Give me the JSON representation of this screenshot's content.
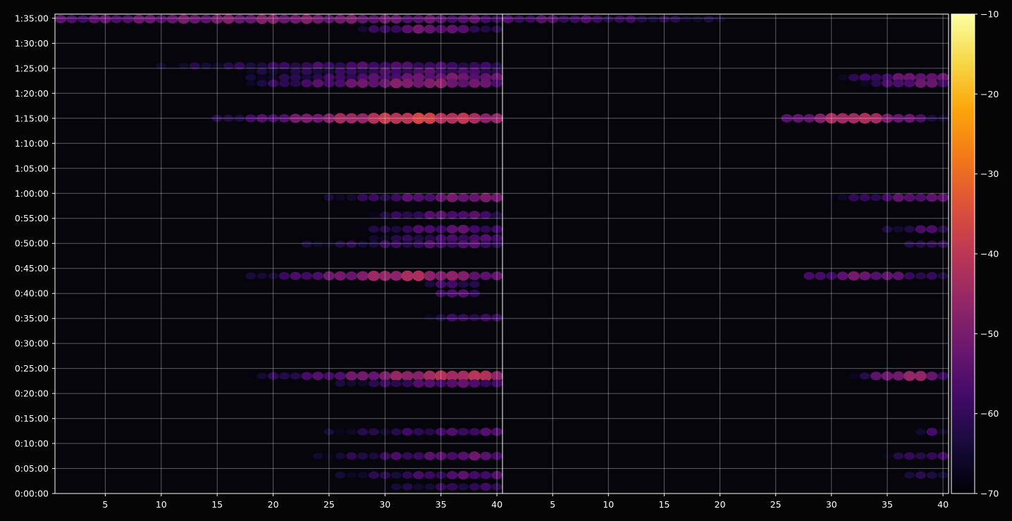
{
  "chart_data": {
    "type": "heatmap",
    "title": "",
    "xlabel": "",
    "ylabel": "",
    "panels": [
      {
        "name": "",
        "xlim": [
          1,
          40
        ],
        "x_ticks": [
          5,
          10,
          15,
          20,
          25,
          30,
          35,
          40
        ]
      },
      {
        "name": "",
        "xlim": [
          1,
          40
        ],
        "x_ticks": [
          5,
          10,
          15,
          20,
          25,
          30,
          35,
          40
        ]
      }
    ],
    "y_axis": {
      "unit": "seconds",
      "range": [
        0,
        5750
      ],
      "ticks": [
        {
          "value": 0,
          "label": "0:00:00"
        },
        {
          "value": 300,
          "label": "0:05:00"
        },
        {
          "value": 600,
          "label": "0:10:00"
        },
        {
          "value": 900,
          "label": "0:15:00"
        },
        {
          "value": 1200,
          "label": "0:20:00"
        },
        {
          "value": 1500,
          "label": "0:25:00"
        },
        {
          "value": 1800,
          "label": "0:30:00"
        },
        {
          "value": 2100,
          "label": "0:35:00"
        },
        {
          "value": 2400,
          "label": "0:40:00"
        },
        {
          "value": 2700,
          "label": "0:45:00"
        },
        {
          "value": 3000,
          "label": "0:50:00"
        },
        {
          "value": 3300,
          "label": "0:55:00"
        },
        {
          "value": 3600,
          "label": "1:00:00"
        },
        {
          "value": 3900,
          "label": "1:05:00"
        },
        {
          "value": 4200,
          "label": "1:10:00"
        },
        {
          "value": 4500,
          "label": "1:15:00"
        },
        {
          "value": 4800,
          "label": "1:20:00"
        },
        {
          "value": 5100,
          "label": "1:25:00"
        },
        {
          "value": 5400,
          "label": "1:30:00"
        },
        {
          "value": 5700,
          "label": "1:35:00"
        }
      ]
    },
    "colorbar": {
      "colormap": "inferno",
      "range": [
        -70,
        -10
      ],
      "ticks": [
        {
          "value": -10,
          "label": "−10"
        },
        {
          "value": -20,
          "label": "−20"
        },
        {
          "value": -30,
          "label": "−30"
        },
        {
          "value": -40,
          "label": "−40"
        },
        {
          "value": -50,
          "label": "−50"
        },
        {
          "value": -60,
          "label": "−60"
        },
        {
          "value": -70,
          "label": "−70"
        }
      ]
    },
    "grid": true,
    "background_value": -70,
    "bands": [
      {
        "panel": 0,
        "t": 5690,
        "x0": 1,
        "x1": 40,
        "peak_x": 20,
        "peak": -50,
        "edge": -57
      },
      {
        "panel": 0,
        "t": 5570,
        "x0": 28,
        "x1": 40,
        "peak_x": 34,
        "peak": -52,
        "edge": -64
      },
      {
        "panel": 0,
        "t": 5130,
        "x0": 10,
        "x1": 40,
        "peak_x": 30,
        "peak": -57,
        "edge": -66
      },
      {
        "panel": 0,
        "t": 5060,
        "x0": 18,
        "x1": 40,
        "peak_x": 34,
        "peak": -57,
        "edge": -66
      },
      {
        "panel": 0,
        "t": 4990,
        "x0": 18,
        "x1": 40,
        "peak_x": 36,
        "peak": -52,
        "edge": -66
      },
      {
        "panel": 0,
        "t": 4920,
        "x0": 18,
        "x1": 40,
        "peak_x": 33,
        "peak": -49,
        "edge": -64
      },
      {
        "panel": 0,
        "t": 4500,
        "x0": 15,
        "x1": 40,
        "peak_x": 33,
        "peak": -38,
        "edge": -64
      },
      {
        "panel": 0,
        "t": 3550,
        "x0": 25,
        "x1": 40,
        "peak_x": 38,
        "peak": -51,
        "edge": -66
      },
      {
        "panel": 0,
        "t": 3340,
        "x0": 29,
        "x1": 40,
        "peak_x": 36,
        "peak": -55,
        "edge": -65
      },
      {
        "panel": 0,
        "t": 3170,
        "x0": 28,
        "x1": 40,
        "peak_x": 36,
        "peak": -55,
        "edge": -66
      },
      {
        "panel": 0,
        "t": 3060,
        "x0": 29,
        "x1": 40,
        "peak_x": 38,
        "peak": -57,
        "edge": -65
      },
      {
        "panel": 0,
        "t": 2990,
        "x0": 23,
        "x1": 40,
        "peak_x": 37,
        "peak": -57,
        "edge": -66
      },
      {
        "panel": 0,
        "t": 2610,
        "x0": 18,
        "x1": 40,
        "peak_x": 32,
        "peak": -44,
        "edge": -66
      },
      {
        "panel": 0,
        "t": 2510,
        "x0": 34,
        "x1": 38,
        "peak_x": 36,
        "peak": -58,
        "edge": -63
      },
      {
        "panel": 0,
        "t": 2400,
        "x0": 35,
        "x1": 38,
        "peak_x": 36,
        "peak": -55,
        "edge": -62
      },
      {
        "panel": 0,
        "t": 2110,
        "x0": 34,
        "x1": 40,
        "peak_x": 38,
        "peak": -59,
        "edge": -64
      },
      {
        "panel": 0,
        "t": 1410,
        "x0": 18,
        "x1": 40,
        "peak_x": 37,
        "peak": -42,
        "edge": -66
      },
      {
        "panel": 0,
        "t": 1320,
        "x0": 26,
        "x1": 40,
        "peak_x": 36,
        "peak": -55,
        "edge": -66
      },
      {
        "panel": 0,
        "t": 740,
        "x0": 25,
        "x1": 40,
        "peak_x": 39,
        "peak": -57,
        "edge": -66
      },
      {
        "panel": 0,
        "t": 450,
        "x0": 24,
        "x1": 40,
        "peak_x": 38,
        "peak": -54,
        "edge": -66
      },
      {
        "panel": 0,
        "t": 220,
        "x0": 26,
        "x1": 40,
        "peak_x": 38,
        "peak": -56,
        "edge": -66
      },
      {
        "panel": 0,
        "t": 80,
        "x0": 30,
        "x1": 40,
        "peak_x": 38,
        "peak": -60,
        "edge": -66
      },
      {
        "panel": 1,
        "t": 5690,
        "x0": 1,
        "x1": 20,
        "peak_x": 4,
        "peak": -57,
        "edge": -66
      },
      {
        "panel": 1,
        "t": 4990,
        "x0": 31,
        "x1": 40,
        "peak_x": 38,
        "peak": -52,
        "edge": -64
      },
      {
        "panel": 1,
        "t": 4920,
        "x0": 33,
        "x1": 40,
        "peak_x": 38,
        "peak": -53,
        "edge": -64
      },
      {
        "panel": 1,
        "t": 4500,
        "x0": 26,
        "x1": 40,
        "peak_x": 32,
        "peak": -42,
        "edge": -64
      },
      {
        "panel": 1,
        "t": 3550,
        "x0": 30,
        "x1": 40,
        "peak_x": 38,
        "peak": -54,
        "edge": -66
      },
      {
        "panel": 1,
        "t": 3170,
        "x0": 35,
        "x1": 40,
        "peak_x": 39,
        "peak": -58,
        "edge": -65
      },
      {
        "panel": 1,
        "t": 2990,
        "x0": 37,
        "x1": 40,
        "peak_x": 39,
        "peak": -59,
        "edge": -65
      },
      {
        "panel": 1,
        "t": 2610,
        "x0": 28,
        "x1": 40,
        "peak_x": 33,
        "peak": -52,
        "edge": -64
      },
      {
        "panel": 1,
        "t": 1410,
        "x0": 32,
        "x1": 40,
        "peak_x": 37,
        "peak": -46,
        "edge": -65
      },
      {
        "panel": 1,
        "t": 450,
        "x0": 35,
        "x1": 40,
        "peak_x": 39,
        "peak": -59,
        "edge": -65
      },
      {
        "panel": 1,
        "t": 740,
        "x0": 38,
        "x1": 40,
        "peak_x": 39,
        "peak": -60,
        "edge": -65
      },
      {
        "panel": 1,
        "t": 220,
        "x0": 37,
        "x1": 40,
        "peak_x": 39,
        "peak": -61,
        "edge": -65
      }
    ]
  }
}
